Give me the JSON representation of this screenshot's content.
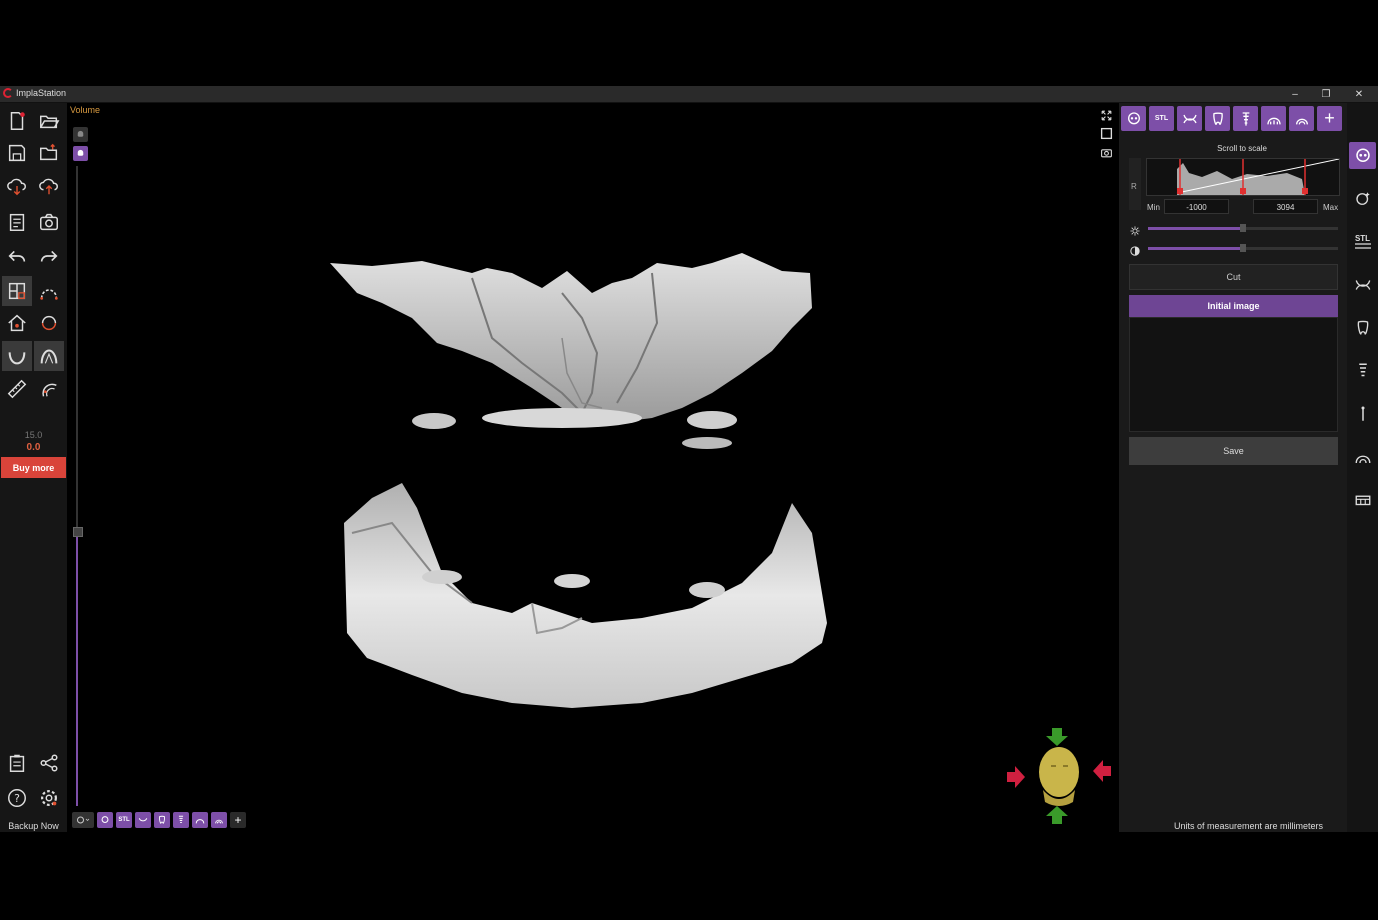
{
  "app": {
    "title": "ImplaStation"
  },
  "window_controls": {
    "minimize": "–",
    "restore": "❐",
    "close": "✕"
  },
  "viewport": {
    "label": "Volume"
  },
  "left_toolbar": {
    "value_top": "15.0",
    "value_bottom": "0.0",
    "buy_more_label": "Buy more",
    "backup_label": "Backup Now"
  },
  "bottom_strip": {
    "stl_label": "STL",
    "plus_label": "+"
  },
  "right_panel": {
    "tabs": [
      {
        "icon": "skull-icon"
      },
      {
        "icon": "stl-icon",
        "label": "STL"
      },
      {
        "icon": "jaw-icon"
      },
      {
        "icon": "tooth-icon"
      },
      {
        "icon": "implant-icon"
      },
      {
        "icon": "arch-icon"
      },
      {
        "icon": "panorama-icon"
      },
      {
        "icon": "plus-icon",
        "label": "+"
      }
    ],
    "scroll_to_scale": "Scroll to scale",
    "r_label": "R",
    "min_label": "Min",
    "max_label": "Max",
    "min_value": "-1000",
    "max_value": "3094",
    "brightness_level": 0.5,
    "contrast_level": 0.5,
    "cut_label": "Cut",
    "initial_image_label": "Initial image",
    "save_label": "Save",
    "units_note": "Units of measurement are millimeters"
  },
  "right_sidebar": {
    "items": [
      "skull-icon",
      "face-scan-icon",
      "stl-icon",
      "jaw-icon",
      "tooth-icon",
      "implant-icon",
      "pin-icon",
      "panorama-icon",
      "bridge-icon"
    ],
    "stl_label": "STL"
  },
  "colors": {
    "accent": "#7d4fa8",
    "buy_more": "#d9443a",
    "orange_label": "#d89a40"
  }
}
